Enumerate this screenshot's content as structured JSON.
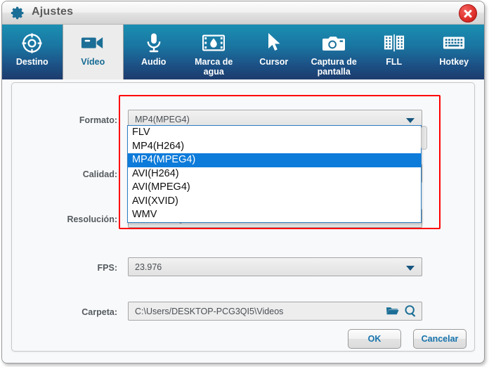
{
  "window": {
    "title": "Ajustes",
    "gear_icon": "gear-icon",
    "close_icon": "close-icon"
  },
  "toolbar": {
    "tabs": [
      {
        "label": "Destino",
        "icon": "target-icon",
        "active": false
      },
      {
        "label": "Vídeo",
        "icon": "camcorder-icon",
        "active": true
      },
      {
        "label": "Audio",
        "icon": "microphone-icon",
        "active": false
      },
      {
        "label": "Marca de\nagua",
        "icon": "watermark-icon",
        "active": false
      },
      {
        "label": "Cursor",
        "icon": "cursor-icon",
        "active": false
      },
      {
        "label": "Captura de\npantalla",
        "icon": "camera-icon",
        "active": false
      },
      {
        "label": "FLL",
        "icon": "film-icon",
        "active": false
      },
      {
        "label": "Hotkey",
        "icon": "keyboard-icon",
        "active": false
      }
    ]
  },
  "form": {
    "formato": {
      "label": "Formato:",
      "value": "MP4(MPEG4)",
      "expanded": true,
      "options": [
        "FLV",
        "MP4(H264)",
        "MP4(MPEG4)",
        "AVI(H264)",
        "AVI(MPEG4)",
        "AVI(XVID)",
        "WMV"
      ],
      "selected_option": "MP4(MPEG4)"
    },
    "calidad": {
      "label": "Calidad:",
      "value": ""
    },
    "resolucion": {
      "label": "Resolución:",
      "value": "Tamaño original"
    },
    "fps": {
      "label": "FPS:",
      "value": "23.976"
    },
    "carpeta": {
      "label": "Carpeta:",
      "value": "C:\\Users/DESKTOP-PCG3QI5\\Videos",
      "folder_icon": "folder-icon",
      "search_icon": "magnifier-icon"
    }
  },
  "footer": {
    "ok_label": "OK",
    "cancel_label": "Cancelar"
  },
  "colors": {
    "toolbar_top": "#1b8fb2",
    "toolbar_bottom": "#1d3b6d",
    "accent_blue": "#1673ac",
    "highlight": "#0d7bda",
    "close_red": "#e2332f",
    "redbox": "#ff0000"
  }
}
